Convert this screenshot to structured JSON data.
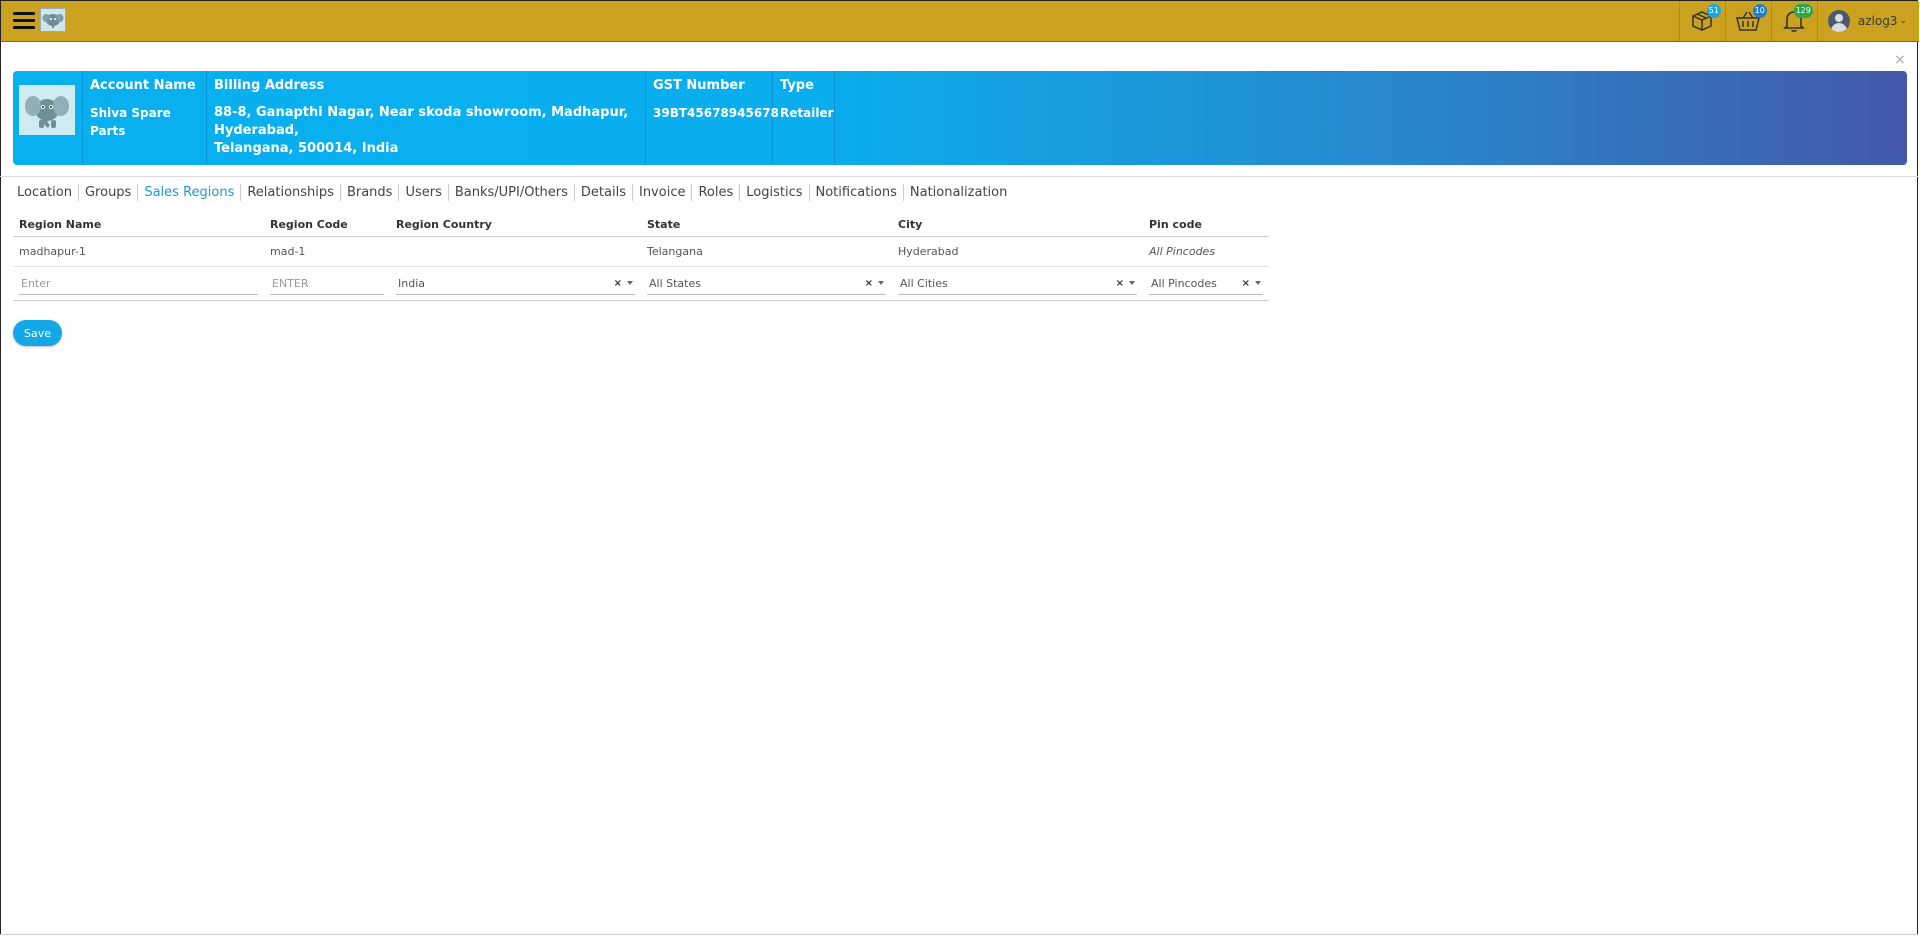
{
  "header": {
    "menu_icon": "hamburger-icon",
    "logo_icon": "elephant-logo-icon",
    "notifications": [
      {
        "icon": "package-icon",
        "count": "51",
        "color": "#19a7e0"
      },
      {
        "icon": "basket-icon",
        "count": "10",
        "color": "#1e7fd0"
      },
      {
        "icon": "bell-icon",
        "count": "129",
        "color": "#2aa84a"
      }
    ],
    "user": {
      "name": "azlog3",
      "icon": "user-avatar-icon"
    }
  },
  "close_icon": "×",
  "account": {
    "name_header": "Account Name",
    "name": "Shiva Spare Parts",
    "billing_header": "Billing Address",
    "billing_lines": [
      "88-8, Ganapthi Nagar, Near skoda showroom, Madhapur,",
      "Hyderabad,",
      "Telangana, 500014, India"
    ],
    "gst_header": "GST Number",
    "gst": "39BT45678945678",
    "type_header": "Type",
    "type": "Retailer"
  },
  "tabs": [
    {
      "label": "Location"
    },
    {
      "label": "Groups"
    },
    {
      "label": "Sales Regions",
      "active": true
    },
    {
      "label": "Relationships"
    },
    {
      "label": "Brands"
    },
    {
      "label": "Users"
    },
    {
      "label": "Banks/UPI/Others"
    },
    {
      "label": "Details"
    },
    {
      "label": "Invoice"
    },
    {
      "label": "Roles"
    },
    {
      "label": "Logistics"
    },
    {
      "label": "Notifications"
    },
    {
      "label": "Nationalization"
    }
  ],
  "table": {
    "columns": [
      "Region Name",
      "Region Code",
      "Region Country",
      "State",
      "City",
      "Pin code"
    ],
    "rows": [
      {
        "region_name": "madhapur-1",
        "region_code": "mad-1",
        "region_country": "",
        "state": "Telangana",
        "city": "Hyderabad",
        "pincode": "All Pincodes"
      }
    ],
    "new_row": {
      "name_placeholder": "Enter",
      "code_placeholder": "ENTER",
      "country": "India",
      "state": "All States",
      "city": "All Cities",
      "pincode": "All Pincodes",
      "clear_glyph": "×"
    }
  },
  "save_label": "Save"
}
